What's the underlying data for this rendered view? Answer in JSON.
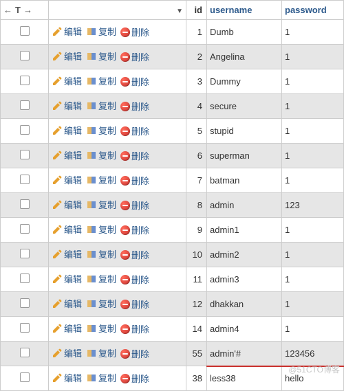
{
  "header": {
    "nav_first": "←",
    "nav_t": "T",
    "nav_last": "→",
    "dropdown": "▼",
    "col_id": "id",
    "col_username": "username",
    "col_password": "password"
  },
  "actions": {
    "edit": "编辑",
    "copy": "复制",
    "delete": "删除"
  },
  "rows": [
    {
      "id": 1,
      "username": "Dumb",
      "password": "1"
    },
    {
      "id": 2,
      "username": "Angelina",
      "password": "1"
    },
    {
      "id": 3,
      "username": "Dummy",
      "password": "1"
    },
    {
      "id": 4,
      "username": "secure",
      "password": "1"
    },
    {
      "id": 5,
      "username": "stupid",
      "password": "1"
    },
    {
      "id": 6,
      "username": "superman",
      "password": "1"
    },
    {
      "id": 7,
      "username": "batman",
      "password": "1"
    },
    {
      "id": 8,
      "username": "admin",
      "password": "123"
    },
    {
      "id": 9,
      "username": "admin1",
      "password": "1"
    },
    {
      "id": 10,
      "username": "admin2",
      "password": "1"
    },
    {
      "id": 11,
      "username": "admin3",
      "password": "1"
    },
    {
      "id": 12,
      "username": "dhakkan",
      "password": "1"
    },
    {
      "id": 14,
      "username": "admin4",
      "password": "1"
    },
    {
      "id": 55,
      "username": "admin'#",
      "password": "123456"
    },
    {
      "id": 38,
      "username": "less38",
      "password": "hello"
    }
  ],
  "highlight_after_id": 55,
  "watermark": "@51CTO博客"
}
